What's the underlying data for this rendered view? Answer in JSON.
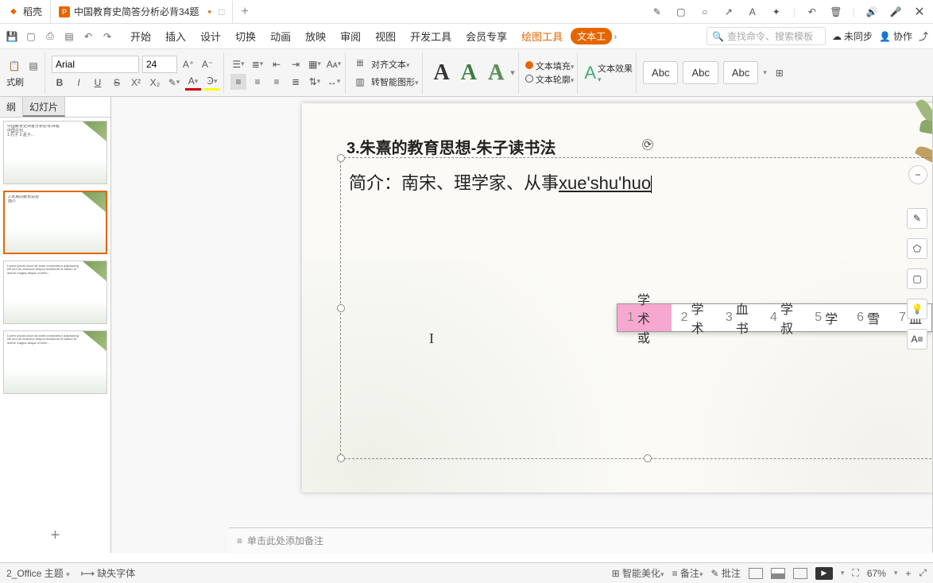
{
  "tabs": {
    "t1": {
      "label": "稻壳"
    },
    "t2": {
      "label": "中国教育史简答分析必背34题"
    }
  },
  "title_icons": [
    "pencil",
    "square",
    "circle",
    "arrow",
    "A",
    "sparkle",
    "sep",
    "undo",
    "trash",
    "sep",
    "speaker",
    "mic",
    "close"
  ],
  "menu": {
    "items": [
      "开始",
      "插入",
      "设计",
      "切换",
      "动画",
      "放映",
      "审阅",
      "视图",
      "开发工具",
      "会员专享"
    ],
    "draw": "绘图工具",
    "texttool": "文本工",
    "search_ph": "查找命令、搜索模板",
    "unsync": "未同步",
    "coop": "协作"
  },
  "toolbar": {
    "brush": "式刷",
    "font": "Arial",
    "size": "24",
    "bold": "B",
    "italic": "I",
    "underline": "U",
    "strike": "S",
    "sup": "X²",
    "sub": "X₂",
    "align_text": "对齐文本",
    "smart_shape": "转智能图形",
    "text_fill": "文本填充",
    "text_outline": "文本轮廓",
    "text_effect": "文本效果",
    "abc": "Abc"
  },
  "left_panel": {
    "tab1": "纲",
    "tab2": "幻灯片"
  },
  "slide": {
    "title": "3.朱熹的教育思想-朱子读书法",
    "body_prefix": "简介：南宋、理学家、从事",
    "ime": "xue'shu'huo"
  },
  "ime_candidates": [
    {
      "n": "1",
      "t": "学术或"
    },
    {
      "n": "2",
      "t": "学术"
    },
    {
      "n": "3",
      "t": "血书"
    },
    {
      "n": "4",
      "t": "学叔"
    },
    {
      "n": "5",
      "t": "学"
    },
    {
      "n": "6",
      "t": "雪"
    },
    {
      "n": "7",
      "t": "血"
    }
  ],
  "notes_placeholder": "单击此处添加备注",
  "status": {
    "theme": "2_Office 主题",
    "missing_font": "缺失字体",
    "beautify": "智能美化",
    "notes": "备注",
    "comments": "批注",
    "zoom": "67%"
  }
}
